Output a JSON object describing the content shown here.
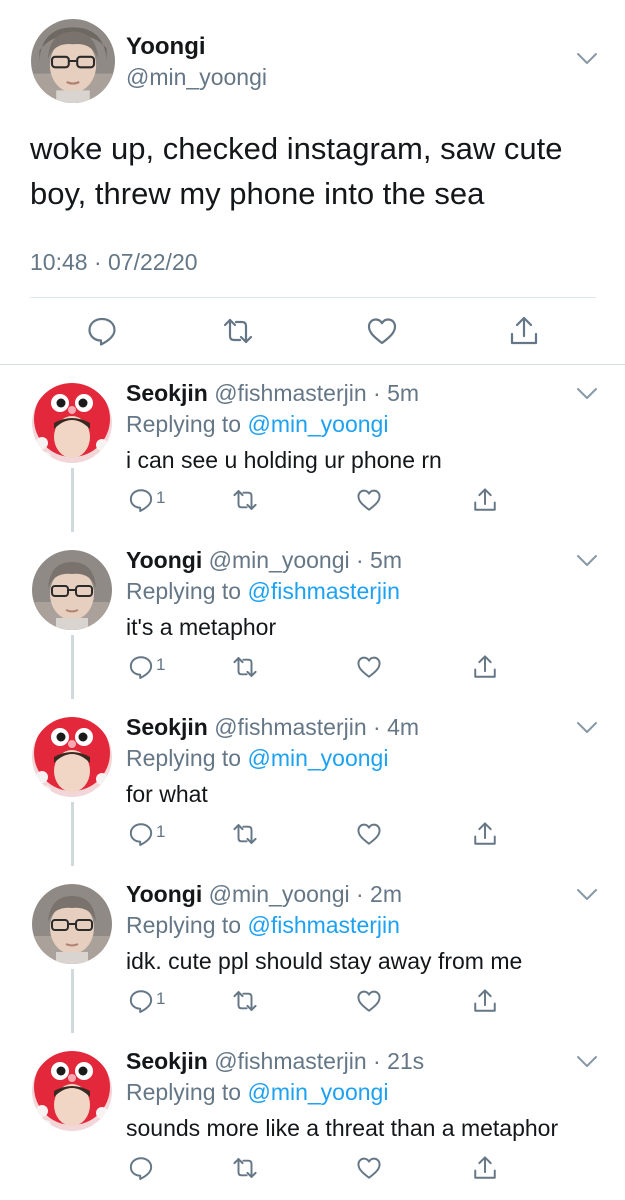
{
  "main_tweet": {
    "name": "Yoongi",
    "handle": "@min_yoongi",
    "text": "woke up, checked instagram, saw cute boy, threw my phone into the sea",
    "timestamp": "10:48 · 07/22/20",
    "icons": [
      "reply-icon",
      "retweet-icon",
      "like-icon",
      "share-icon"
    ]
  },
  "replies": [
    {
      "name": "Seokjin",
      "handle_time": "@fishmasterjin · 5m",
      "replying_prefix": "Replying to",
      "replying_to": "@min_yoongi",
      "text": "i can see u holding ur phone rn",
      "reply_count": "1",
      "avatar": "red-octopus-hood"
    },
    {
      "name": "Yoongi",
      "handle_time": "@min_yoongi · 5m",
      "replying_prefix": "Replying to",
      "replying_to": "@fishmasterjin",
      "text": "it's a metaphor",
      "reply_count": "1",
      "avatar": "glasses"
    },
    {
      "name": "Seokjin",
      "handle_time": "@fishmasterjin · 4m",
      "replying_prefix": "Replying to",
      "replying_to": "@min_yoongi",
      "text": "for what",
      "reply_count": "1",
      "avatar": "red-octopus-hood"
    },
    {
      "name": "Yoongi",
      "handle_time": "@min_yoongi · 2m",
      "replying_prefix": "Replying to",
      "replying_to": "@fishmasterjin",
      "text": "idk. cute ppl should stay away from me",
      "reply_count": "1",
      "avatar": "glasses"
    },
    {
      "name": "Seokjin",
      "handle_time": "@fishmasterjin · 21s",
      "replying_prefix": "Replying to",
      "replying_to": "@min_yoongi",
      "text": "sounds more like a threat than a metaphor",
      "reply_count": "",
      "avatar": "red-octopus-hood"
    }
  ],
  "colors": {
    "text": "#14171a",
    "secondary": "#657786",
    "link": "#1da1f2",
    "icon": "#657786",
    "divider": "#e1e8ed"
  }
}
